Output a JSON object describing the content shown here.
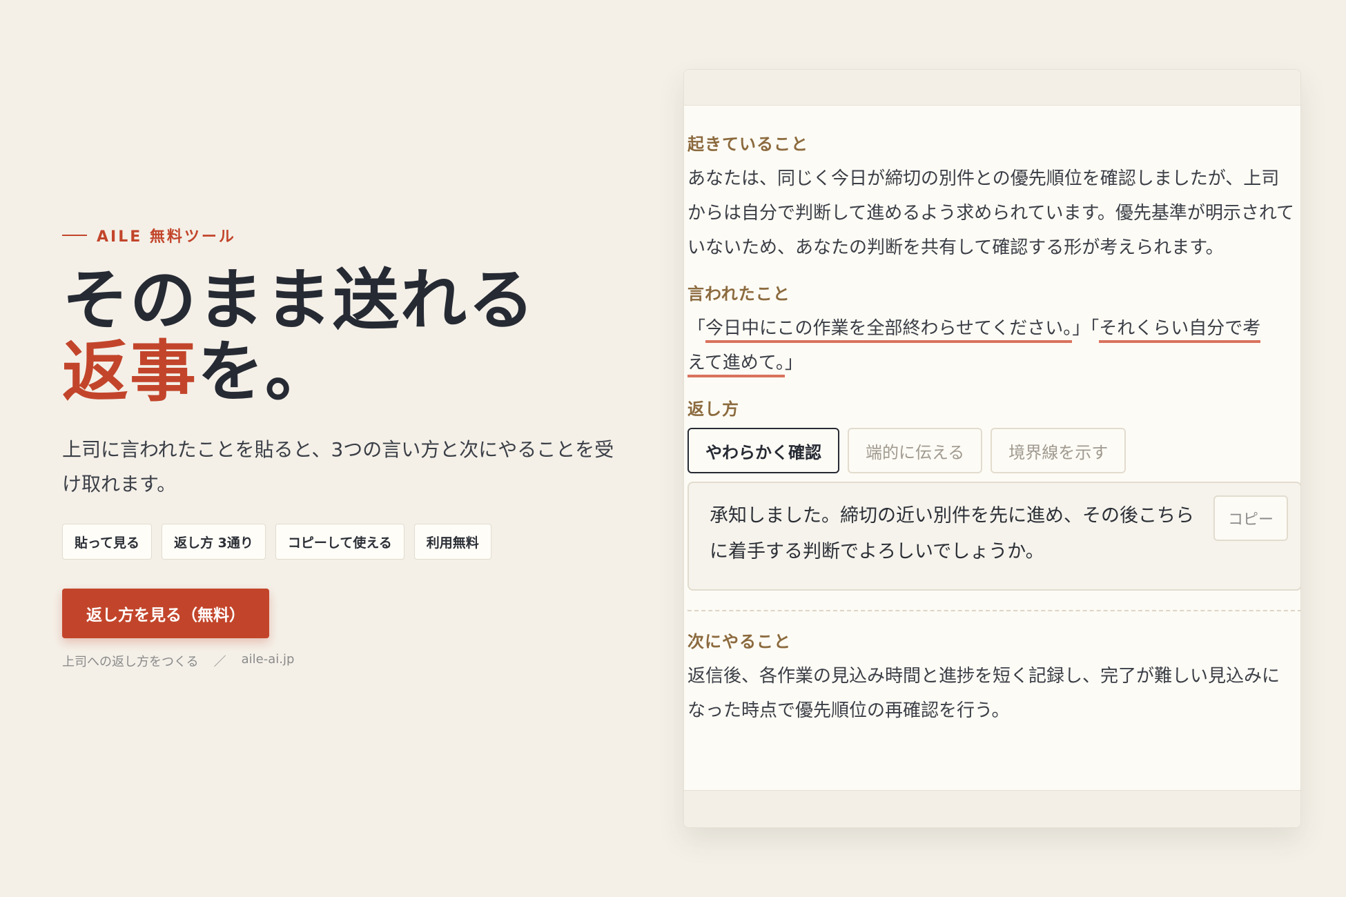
{
  "hero": {
    "eyebrow": "AILE 無料ツール",
    "headline_line1": "そのまま送れる",
    "headline_accent": "返事",
    "headline_tail": "を。",
    "lead": "上司に言われたことを貼ると、3つの言い方と次にやることを受け取れます。",
    "chips": [
      "貼って見る",
      "返し方 3通り",
      "コピーして使える",
      "利用無料"
    ],
    "cta_label": "返し方を見る（無料）",
    "footer_text": "上司への返し方をつくる",
    "footer_sep": "／",
    "footer_domain": "aile-ai.jp"
  },
  "panel": {
    "happening_label": "起きていること",
    "happening_text": "あなたは、同じく今日が締切の別件との優先順位を確認しましたが、上司からは自分で判断して進めるよう求められています。優先基準が明示されていないため、あなたの判断を共有して確認する形が考えられます。",
    "said_label": "言われたこと",
    "said_quote1": "今日中にこの作業を全部終わらせてください。",
    "said_quote2_part1": "それくらい自分で考",
    "said_quote2_part2": "えて進めて。",
    "reply_label": "返し方",
    "tabs": [
      "やわらかく確認",
      "端的に伝える",
      "境界線を示す"
    ],
    "active_tab": 0,
    "reply_text": "承知しました。締切の近い別件を先に進め、その後こちらに着手する判断でよろしいでしょうか。",
    "copy_label": "コピー",
    "next_label": "次にやること",
    "next_text": "返信後、各作業の見込み時間と進捗を短く記録し、完了が難しい見込みになった時点で優先順位の再確認を行う。"
  },
  "colors": {
    "accent": "#c2452b",
    "label_brown": "#8b6a3e",
    "background": "#f4f0e8"
  }
}
